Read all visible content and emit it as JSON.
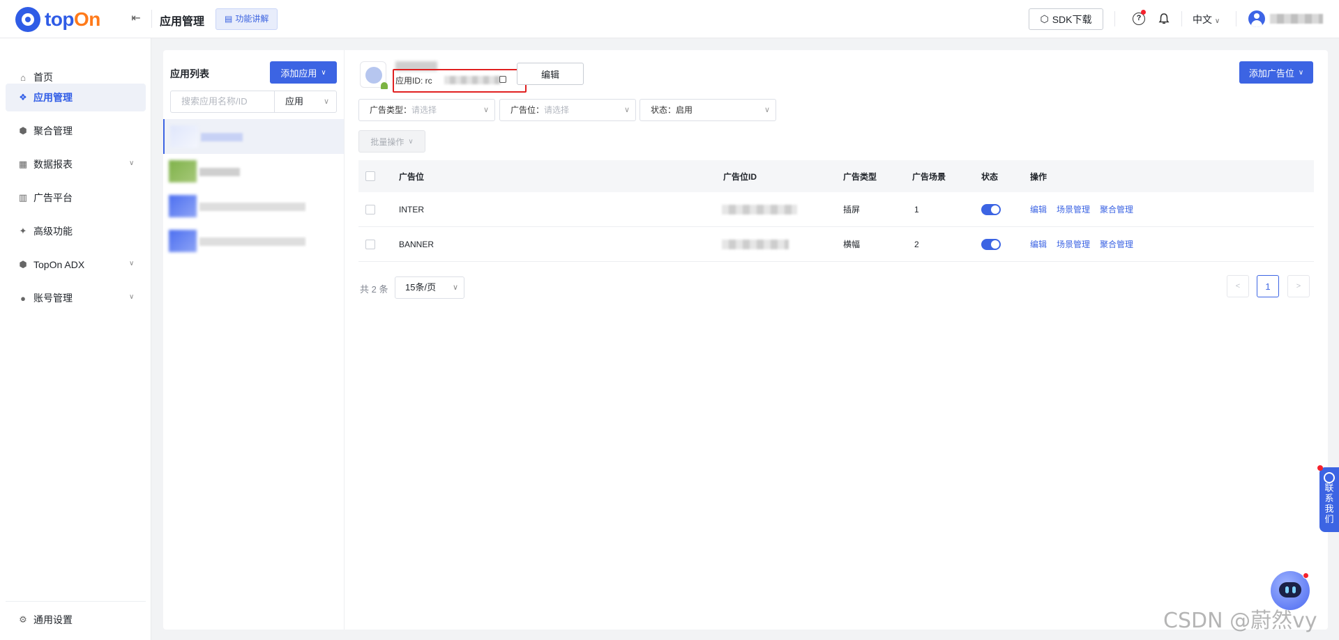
{
  "header": {
    "logo_text_1": "top",
    "logo_text_2": "On",
    "page_title": "应用管理",
    "feature_button": "功能讲解",
    "sdk_button": "SDK下载",
    "language": "中文"
  },
  "sidebar": {
    "items": [
      {
        "label": "首页",
        "icon": "home-icon"
      },
      {
        "label": "应用管理",
        "icon": "app-icon",
        "active": true
      },
      {
        "label": "聚合管理",
        "icon": "aggregate-icon"
      },
      {
        "label": "数据报表",
        "icon": "report-icon",
        "expandable": true
      },
      {
        "label": "广告平台",
        "icon": "ad-platform-icon"
      },
      {
        "label": "高级功能",
        "icon": "sparkle-icon"
      },
      {
        "label": "TopOn ADX",
        "icon": "adx-icon",
        "expandable": true
      },
      {
        "label": "账号管理",
        "icon": "user-icon",
        "expandable": true
      }
    ],
    "settings_label": "通用设置"
  },
  "app_list": {
    "title": "应用列表",
    "add_button": "添加应用",
    "search_placeholder": "搜索应用名称/ID",
    "type_select": "应用"
  },
  "detail": {
    "app_id_label": "应用ID: rc",
    "edit_button": "编辑",
    "add_slot_button": "添加广告位",
    "filters": [
      {
        "label": "广告类型：",
        "value": "请选择",
        "placeholder": true
      },
      {
        "label": "广告位：",
        "value": "请选择",
        "placeholder": true
      },
      {
        "label": "状态：",
        "value": "启用",
        "placeholder": false
      }
    ],
    "batch_button": "批量操作"
  },
  "table": {
    "headers": [
      "广告位",
      "广告位ID",
      "广告类型",
      "广告场景",
      "状态",
      "操作"
    ],
    "rows": [
      {
        "name": "INTER",
        "type": "插屏",
        "scenes": "1",
        "enabled": true
      },
      {
        "name": "BANNER",
        "type": "横幅",
        "scenes": "2",
        "enabled": true
      }
    ],
    "actions": [
      "编辑",
      "场景管理",
      "聚合管理"
    ]
  },
  "pagination": {
    "total": "共 2 条",
    "page_size": "15条/页",
    "current_page": "1"
  },
  "float": {
    "contact_label": "联系我们",
    "watermark": "CSDN @蔚然vy"
  },
  "colors": {
    "primary": "#3c64e3",
    "highlight": "#e02020"
  }
}
